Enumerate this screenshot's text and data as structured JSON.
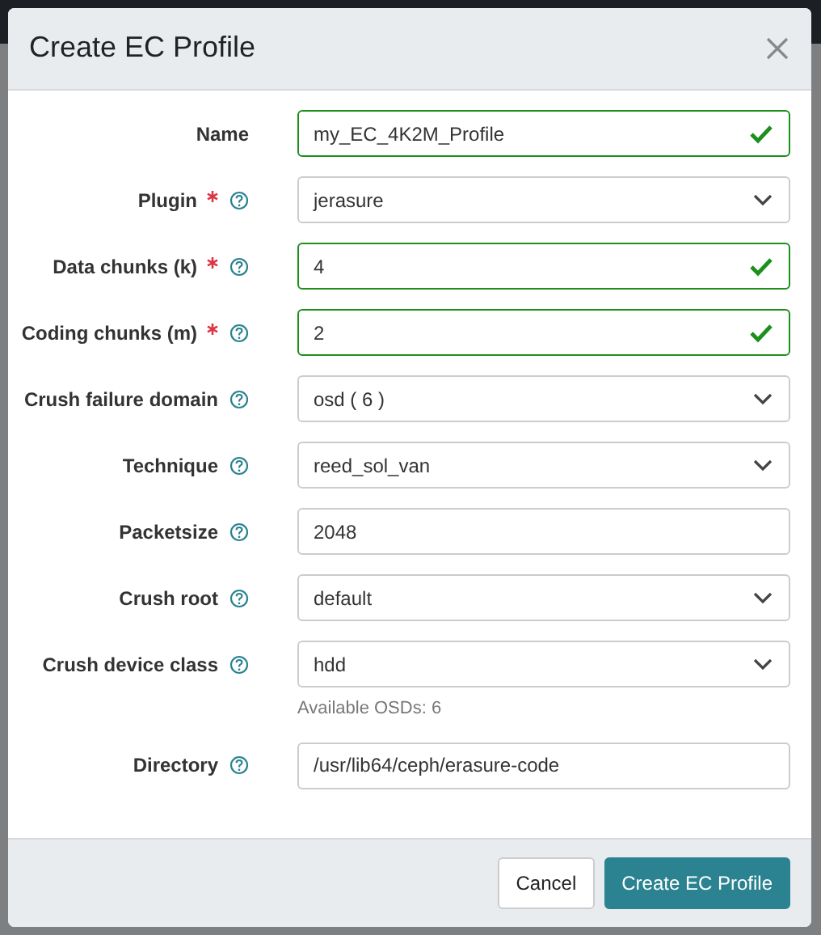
{
  "dialog": {
    "title": "Create EC Profile",
    "fields": [
      {
        "label": "Name",
        "kind": "input",
        "value": "my_EC_4K2M_Profile",
        "required": false,
        "help": false,
        "valid": true
      },
      {
        "label": "Plugin",
        "kind": "select",
        "value": "jerasure",
        "required": true,
        "help": true,
        "valid": false
      },
      {
        "label": "Data chunks (k)",
        "kind": "input",
        "value": "4",
        "required": true,
        "help": true,
        "valid": true
      },
      {
        "label": "Coding chunks (m)",
        "kind": "input",
        "value": "2",
        "required": true,
        "help": true,
        "valid": true
      },
      {
        "label": "Crush failure domain",
        "kind": "select",
        "value": "osd ( 6 )",
        "required": false,
        "help": true,
        "valid": false
      },
      {
        "label": "Technique",
        "kind": "select",
        "value": "reed_sol_van",
        "required": false,
        "help": true,
        "valid": false
      },
      {
        "label": "Packetsize",
        "kind": "input",
        "value": "2048",
        "required": false,
        "help": true,
        "valid": false
      },
      {
        "label": "Crush root",
        "kind": "select",
        "value": "default",
        "required": false,
        "help": true,
        "valid": false
      },
      {
        "label": "Crush device class",
        "kind": "select",
        "value": "hdd",
        "required": false,
        "help": true,
        "valid": false,
        "hint": "Available OSDs: 6"
      },
      {
        "label": "Directory",
        "kind": "input",
        "value": "/usr/lib64/ceph/erasure-code",
        "required": false,
        "help": true,
        "valid": false
      }
    ],
    "buttons": [
      {
        "label": "Cancel",
        "kind": "secondary"
      },
      {
        "label": "Create EC Profile",
        "kind": "primary"
      }
    ]
  }
}
